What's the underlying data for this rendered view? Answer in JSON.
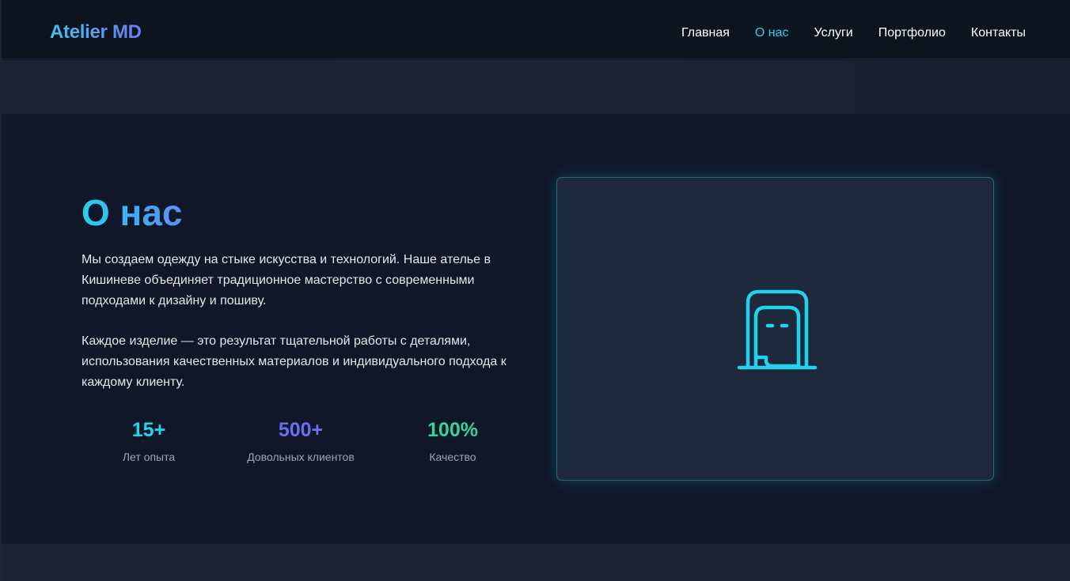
{
  "header": {
    "logo": "Atelier MD",
    "nav": [
      {
        "label": "Главная",
        "active": false
      },
      {
        "label": "О нас",
        "active": true
      },
      {
        "label": "Услуги",
        "active": false
      },
      {
        "label": "Портфолио",
        "active": false
      },
      {
        "label": "Контакты",
        "active": false
      }
    ]
  },
  "about": {
    "title": "О нас",
    "paragraph_1": "Мы создаем одежду на стыке искусства и технологий. Наше ателье в Кишиневе объединяет традиционное мастерство с современными подходами к дизайну и пошиву.",
    "paragraph_2": "Каждое изделие — это результат тщательной работы с деталями, использования качественных материалов и индивидуального подхода к каждому клиенту.",
    "stats": [
      {
        "value": "15+",
        "label": "Лет опыта",
        "color": "#22d3ee"
      },
      {
        "value": "500+",
        "label": "Довольных клиентов",
        "color": "#6b6ef0"
      },
      {
        "value": "100%",
        "label": "Качество",
        "color": "#34d399"
      }
    ]
  },
  "card": {
    "icon": "atelier-icon",
    "accent": "#22d3ee"
  },
  "colors": {
    "background": "#0f1728",
    "header": "#0d1420",
    "card": "#1e293b",
    "nav_active": "#22d3ee"
  }
}
